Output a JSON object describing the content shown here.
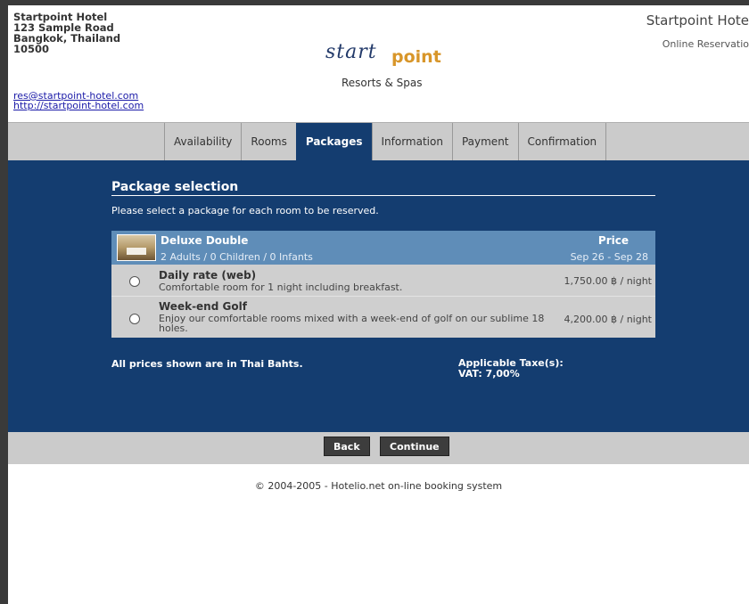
{
  "hotel": {
    "address_lines": [
      "Startpoint Hotel",
      "123 Sample Road",
      "Bangkok, Thailand",
      "10500"
    ],
    "email": "res@startpoint-hotel.com",
    "website": "http://startpoint-hotel.com",
    "right_title": "Startpoint Hote",
    "right_sub": "Online Reservatio"
  },
  "logo": {
    "word_start": "start",
    "word_point": "point",
    "subtitle": "Resorts & Spas"
  },
  "tabs": [
    {
      "label": "Availability",
      "active": false
    },
    {
      "label": "Rooms",
      "active": false
    },
    {
      "label": "Packages",
      "active": true
    },
    {
      "label": "Information",
      "active": false
    },
    {
      "label": "Payment",
      "active": false
    },
    {
      "label": "Confirmation",
      "active": false
    }
  ],
  "selection": {
    "title": "Package selection",
    "instruction": "Please select a package for each room to be reserved.",
    "room": {
      "name": "Deluxe Double",
      "occupancy": "2 Adults / 0 Children / 0 Infants",
      "price_header": "Price",
      "dates": "Sep 26 - Sep 28"
    },
    "packages": [
      {
        "name": "Daily rate (web)",
        "description": "Comfortable room for 1 night including breakfast.",
        "price": "1,750.00 ฿ / night",
        "selected": false
      },
      {
        "name": "Week-end Golf",
        "description": "Enjoy our comfortable rooms mixed with a week-end of golf on our sublime 18 holes.",
        "price": "4,200.00 ฿ / night",
        "selected": false
      }
    ],
    "currency_note": "All prices shown are in Thai Bahts.",
    "tax_label": "Applicable Taxe(s):",
    "tax_value": "VAT: 7,00%"
  },
  "buttons": {
    "back": "Back",
    "continue": "Continue"
  },
  "footer": "© 2004-2005 - Hotelio.net on-line booking system",
  "colors": {
    "main_bg": "#143d70",
    "room_header_bg": "#5f8db8",
    "bar_bg": "#cbcbcb",
    "button_bg": "#3d3d3d",
    "logo_blue": "#233a6a",
    "logo_orange": "#d8962a"
  }
}
